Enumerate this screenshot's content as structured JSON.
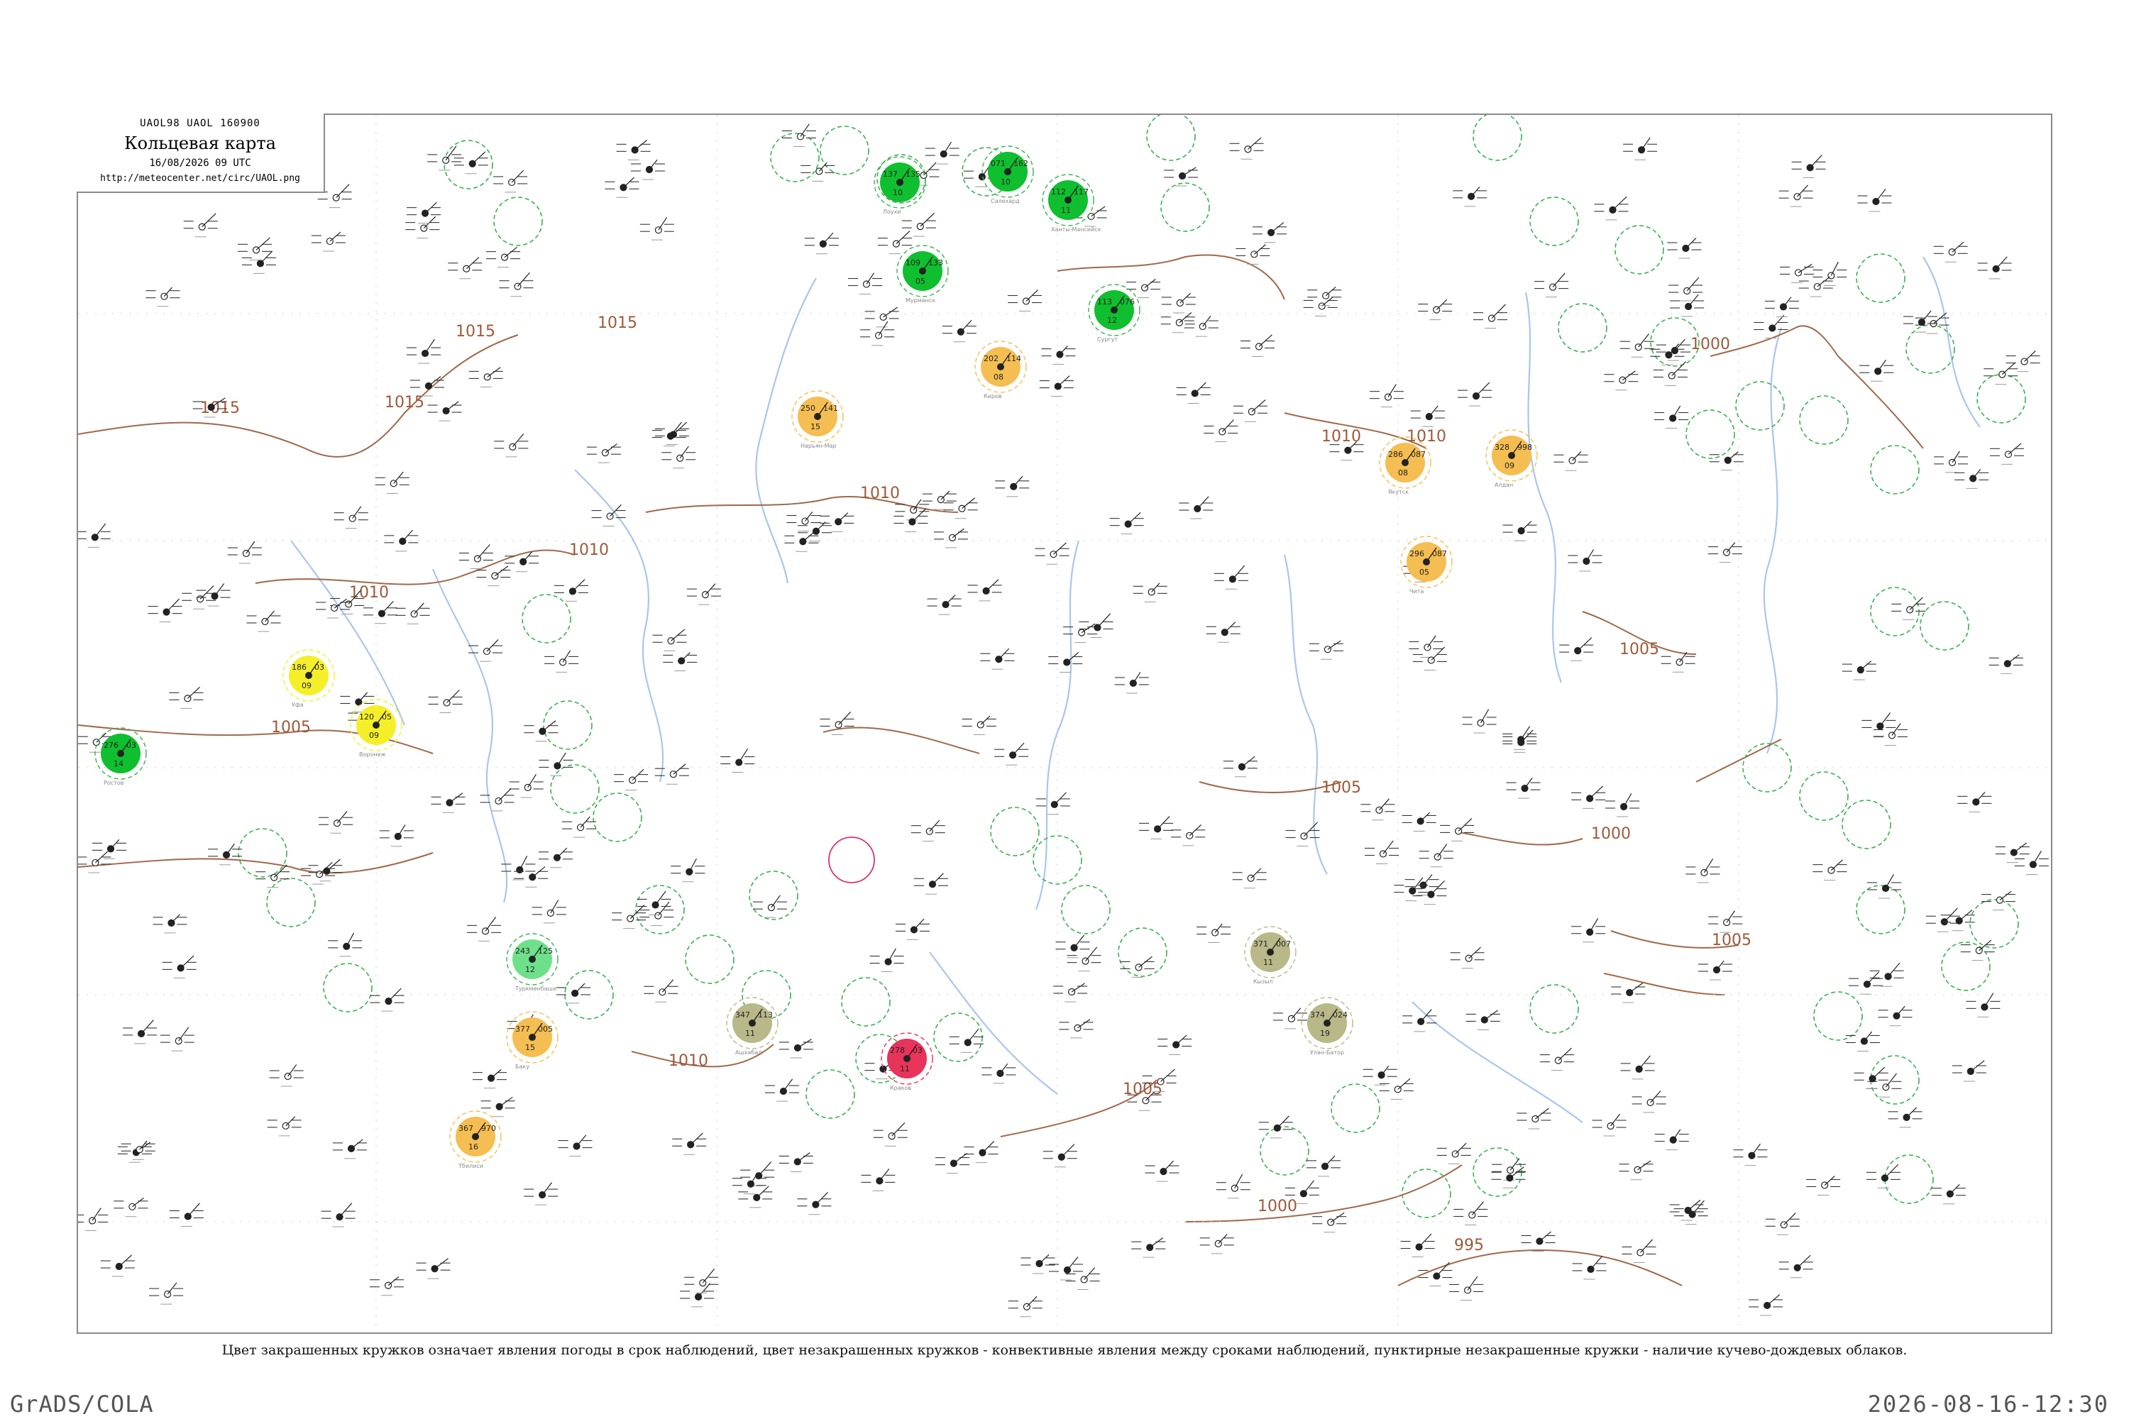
{
  "header": {
    "code_line": "UAOL98  UAOL  160900",
    "title": "Кольцевая карта",
    "date_line": "16/08/2026 09 UTC",
    "url": "http://meteocenter.net/circ/UAOL.png"
  },
  "isobars": [
    {
      "label": "1015"
    },
    {
      "label": "1015"
    },
    {
      "label": "1015"
    },
    {
      "label": "1015"
    },
    {
      "label": "1010"
    },
    {
      "label": "1010"
    },
    {
      "label": "1010"
    },
    {
      "label": "1010"
    },
    {
      "label": "1010"
    },
    {
      "label": "1010"
    },
    {
      "label": "1005"
    },
    {
      "label": "1005"
    },
    {
      "label": "1005"
    },
    {
      "label": "1005"
    },
    {
      "label": "1005"
    },
    {
      "label": "1000"
    },
    {
      "label": "1000"
    },
    {
      "label": "1000"
    },
    {
      "label": "995"
    }
  ],
  "weather_colors": {
    "rain": "#0fbf2f",
    "rain_light": "#6ee08a",
    "fog_haze": "#f5be52",
    "dust": "#b8b888",
    "snow_sleet": "#f5ef2a",
    "thunder": "#e8335a",
    "cb_ring": "#37b24d",
    "thunder_ring": "#d6337a",
    "isobar": "#a0684a",
    "river": "#a9c6ee"
  },
  "stations": [
    {
      "name": "Лоухи",
      "temp": "137",
      "pressure": "135",
      "dew": "10",
      "weather": "rain"
    },
    {
      "name": "Мурманск",
      "temp": "109",
      "pressure": "133",
      "dew": "05",
      "weather": "rain"
    },
    {
      "name": "Салехард",
      "temp": "071",
      "pressure": "162",
      "dew": "10",
      "weather": "rain"
    },
    {
      "name": "Ханты-Мансийск",
      "temp": "112",
      "pressure": "117",
      "dew": "11",
      "weather": "rain"
    },
    {
      "name": "Сургут",
      "temp": "113",
      "pressure": "076",
      "dew": "12",
      "weather": "rain"
    },
    {
      "name": "Нарьян-Мар",
      "temp": "250",
      "pressure": "141",
      "dew": "15",
      "weather": "fog_haze"
    },
    {
      "name": "Киров",
      "temp": "202",
      "pressure": "114",
      "dew": "08",
      "weather": "fog_haze"
    },
    {
      "name": "Уфа",
      "temp": "186",
      "pressure": "03",
      "dew": "09",
      "weather": "snow_sleet"
    },
    {
      "name": "Воронеж",
      "temp": "120",
      "pressure": "05",
      "dew": "09",
      "weather": "snow_sleet"
    },
    {
      "name": "Ростов",
      "temp": "276",
      "pressure": "03",
      "dew": "14",
      "weather": "rain"
    },
    {
      "name": "Тбилиси",
      "temp": "367",
      "pressure": "970",
      "dew": "16",
      "weather": "fog_haze"
    },
    {
      "name": "Баку",
      "temp": "377",
      "pressure": "005",
      "dew": "15",
      "weather": "fog_haze"
    },
    {
      "name": "Ашхабад",
      "temp": "347",
      "pressure": "113",
      "dew": "11",
      "weather": "dust"
    },
    {
      "name": "Кызыл",
      "temp": "371",
      "pressure": "007",
      "dew": "11",
      "weather": "dust"
    },
    {
      "name": "Улан-Батор",
      "temp": "374",
      "pressure": "024",
      "dew": "19",
      "weather": "dust"
    },
    {
      "name": "Краков",
      "temp": "278",
      "pressure": "03",
      "dew": "11",
      "weather": "thunder"
    },
    {
      "name": "Туркменбаши",
      "temp": "243",
      "pressure": "125",
      "dew": "12",
      "weather": "rain_light"
    },
    {
      "name": "Якутск",
      "temp": "286",
      "pressure": "087",
      "dew": "08",
      "weather": "fog_haze"
    },
    {
      "name": "Чита",
      "temp": "296",
      "pressure": "087",
      "dew": "05",
      "weather": "fog_haze"
    },
    {
      "name": "Алдан",
      "temp": "328",
      "pressure": "998",
      "dew": "09",
      "weather": "fog_haze"
    }
  ],
  "caption": "Цвет закрашенных кружков означает явления погоды в срок наблюдений, цвет незакрашенных кружков - конвективные явления между сроками наблюдений, пунктирные незакрашенные кружки - наличие кучево-дождевых облаков.",
  "footer": {
    "left": "GrADS/COLA",
    "right": "2026-08-16-12:30"
  }
}
